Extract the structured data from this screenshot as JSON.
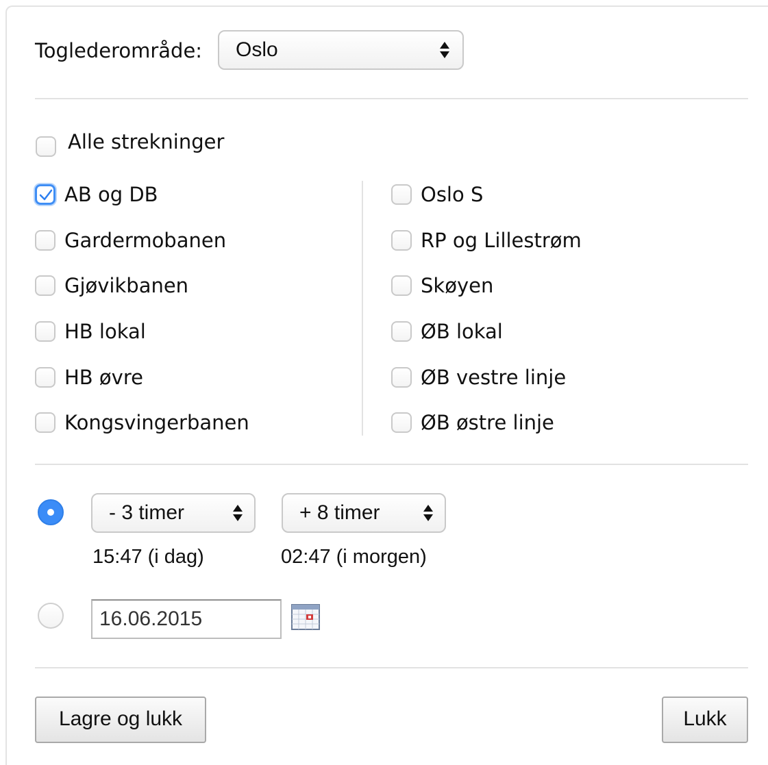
{
  "area": {
    "label": "Toglederområde:",
    "selected": "Oslo"
  },
  "all_lines": {
    "label": "Alle strekninger",
    "checked": false
  },
  "lines_left": [
    {
      "label": "AB og DB",
      "checked": true
    },
    {
      "label": "Gardermobanen",
      "checked": false
    },
    {
      "label": "Gjøvikbanen",
      "checked": false
    },
    {
      "label": "HB lokal",
      "checked": false
    },
    {
      "label": "HB øvre",
      "checked": false
    },
    {
      "label": "Kongsvingerbanen",
      "checked": false
    }
  ],
  "lines_right": [
    {
      "label": "Oslo S",
      "checked": false
    },
    {
      "label": "RP og Lillestrøm",
      "checked": false
    },
    {
      "label": "Skøyen",
      "checked": false
    },
    {
      "label": "ØB lokal",
      "checked": false
    },
    {
      "label": "ØB vestre linje",
      "checked": false
    },
    {
      "label": "ØB østre linje",
      "checked": false
    }
  ],
  "time_range": {
    "selected": true,
    "from_select": "- 3 timer",
    "to_select": "+ 8 timer",
    "from_time": "15:47 (i dag)",
    "to_time": "02:47 (i morgen)"
  },
  "date_option": {
    "selected": false,
    "date_value": "16.06.2015",
    "icon": "calendar-icon"
  },
  "buttons": {
    "save_close": "Lagre og lukk",
    "close": "Lukk"
  },
  "colors": {
    "accent": "#3b8cf7",
    "divider": "#e2e2e2"
  }
}
